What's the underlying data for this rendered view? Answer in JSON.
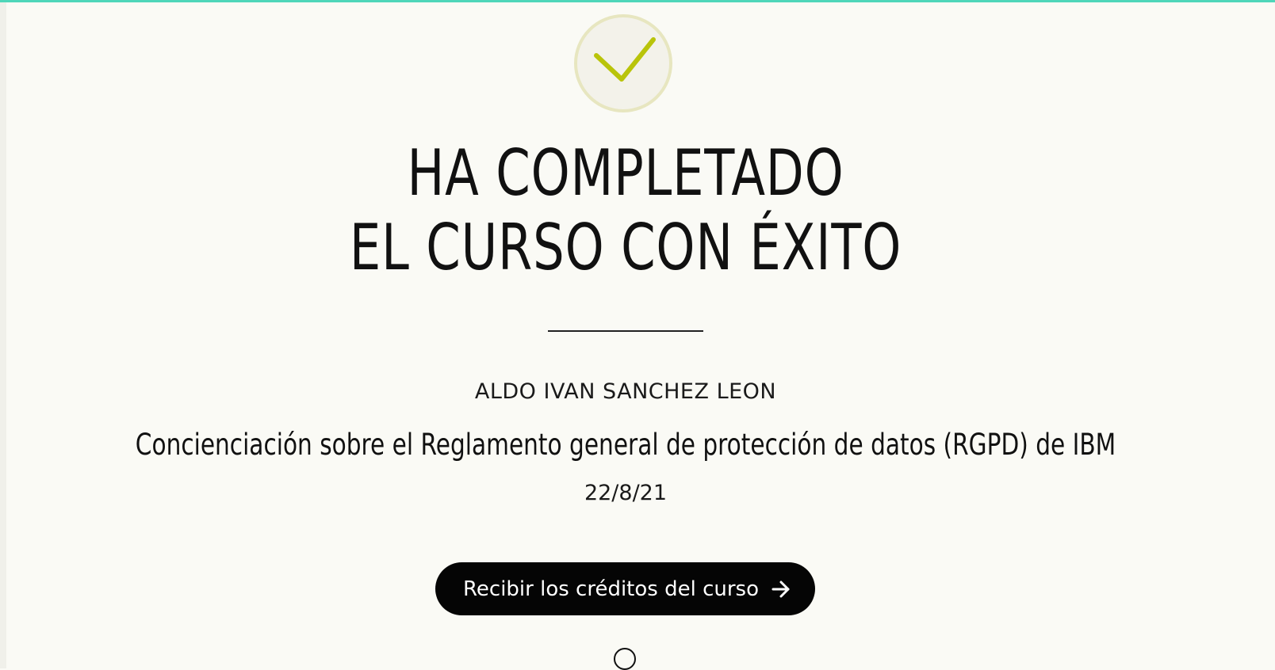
{
  "colors": {
    "accent_bar": "#4fd6b9",
    "check_color": "#b9c40a",
    "background": "#fafaf5",
    "button_bg": "#050505"
  },
  "status_icon": "checkmark-icon",
  "headline": {
    "line1": "HA COMPLETADO",
    "line2": "EL CURSO CON ÉXITO"
  },
  "student": {
    "name": "ALDO IVAN SANCHEZ LEON"
  },
  "course": {
    "title": "Concienciación sobre el Reglamento general de protección de datos (RGPD) de IBM",
    "date": "22/8/21"
  },
  "actions": {
    "receive_credits_label": "Recibir los créditos del curso",
    "receive_credits_icon": "arrow-right-icon"
  }
}
